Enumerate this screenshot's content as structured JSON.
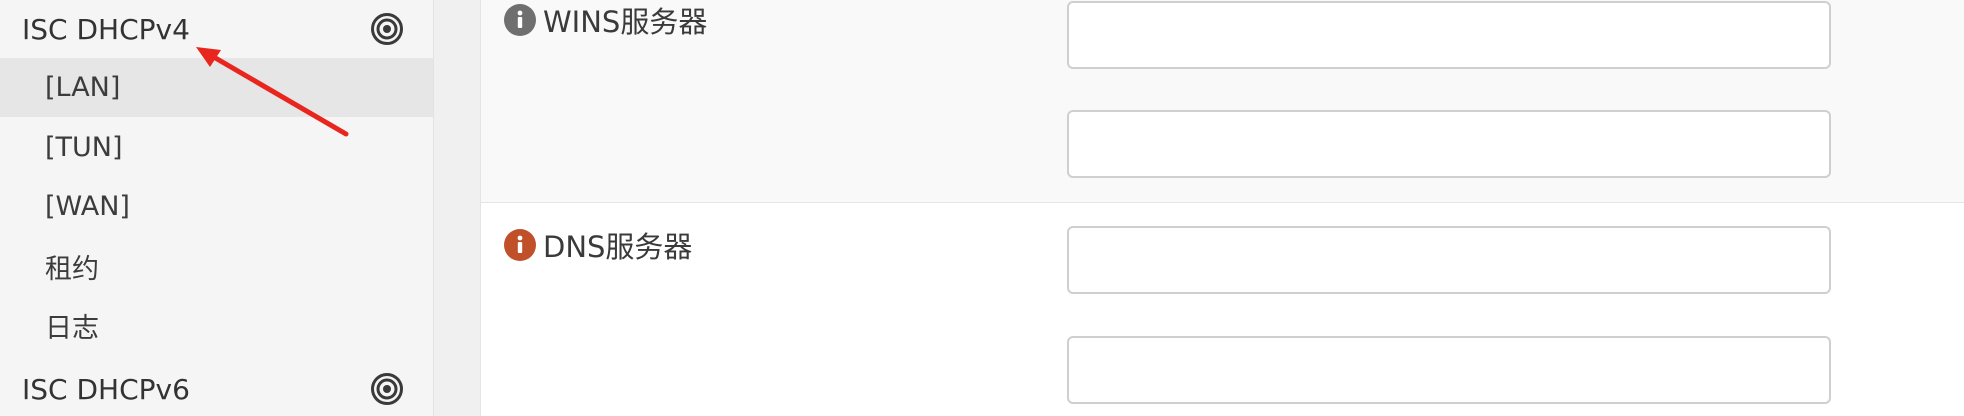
{
  "sidebar": {
    "sections": [
      {
        "label": "ISC DHCPv4",
        "icon": "target-icon"
      },
      {
        "label": "ISC DHCPv6",
        "icon": "target-icon"
      }
    ],
    "items": [
      {
        "label": "[LAN]",
        "active": true
      },
      {
        "label": "[TUN]",
        "active": false
      },
      {
        "label": "[WAN]",
        "active": false
      },
      {
        "label": "租约",
        "active": false
      },
      {
        "label": "日志",
        "active": false
      }
    ]
  },
  "form": {
    "wins": {
      "label": "WINS服务器",
      "icon": "info-icon",
      "icon_color": "#6f6f6f",
      "inputs": [
        {
          "value": "",
          "placeholder": ""
        },
        {
          "value": "",
          "placeholder": ""
        }
      ]
    },
    "dns": {
      "label": "DNS服务器",
      "icon": "info-icon",
      "icon_color": "#c0502a",
      "inputs": [
        {
          "value": "",
          "placeholder": ""
        },
        {
          "value": "",
          "placeholder": ""
        }
      ]
    }
  },
  "annotation": {
    "arrow_color": "#e8261e"
  },
  "colors": {
    "sidebar_bg": "#f5f5f5",
    "active_item_bg": "#e6e6e6",
    "info_gray": "#6f6f6f",
    "info_orange": "#c0502a"
  }
}
